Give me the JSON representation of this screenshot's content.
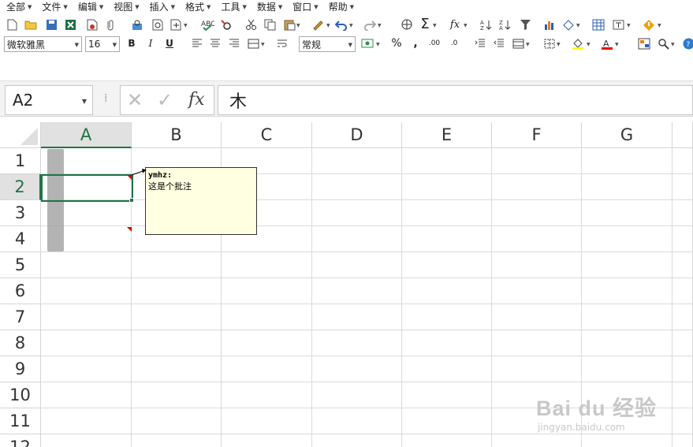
{
  "menubar": {
    "items": [
      "全部",
      "文件",
      "编辑",
      "视图",
      "插入",
      "格式",
      "工具",
      "数据",
      "窗口",
      "帮助"
    ]
  },
  "toolbar": {
    "font_name": "微软雅黑",
    "font_size": "16",
    "bold": "B",
    "italic": "I",
    "underline": "U",
    "number_format": "常规",
    "percent": "%",
    "comma": ",",
    "inc_decimal": ".00",
    "dec_decimal": ".0"
  },
  "formula_bar": {
    "name_box": "A2",
    "fx": "fx",
    "content": "木"
  },
  "grid": {
    "columns": [
      "A",
      "B",
      "C",
      "D",
      "E",
      "F",
      "G"
    ],
    "rows": [
      "1",
      "2",
      "3",
      "4",
      "5",
      "6",
      "7",
      "8",
      "9",
      "10",
      "11",
      "12"
    ],
    "selected_column": "A",
    "selected_row": "2"
  },
  "comment": {
    "author": "ymhz:",
    "text": "这是个批注"
  },
  "watermark": {
    "logo": "Bai du 经验",
    "url": "jingyan.baidu.com"
  },
  "colors": {
    "accent": "#217346",
    "comment_bg": "#ffffe1",
    "comment_indicator": "#dd0000"
  }
}
